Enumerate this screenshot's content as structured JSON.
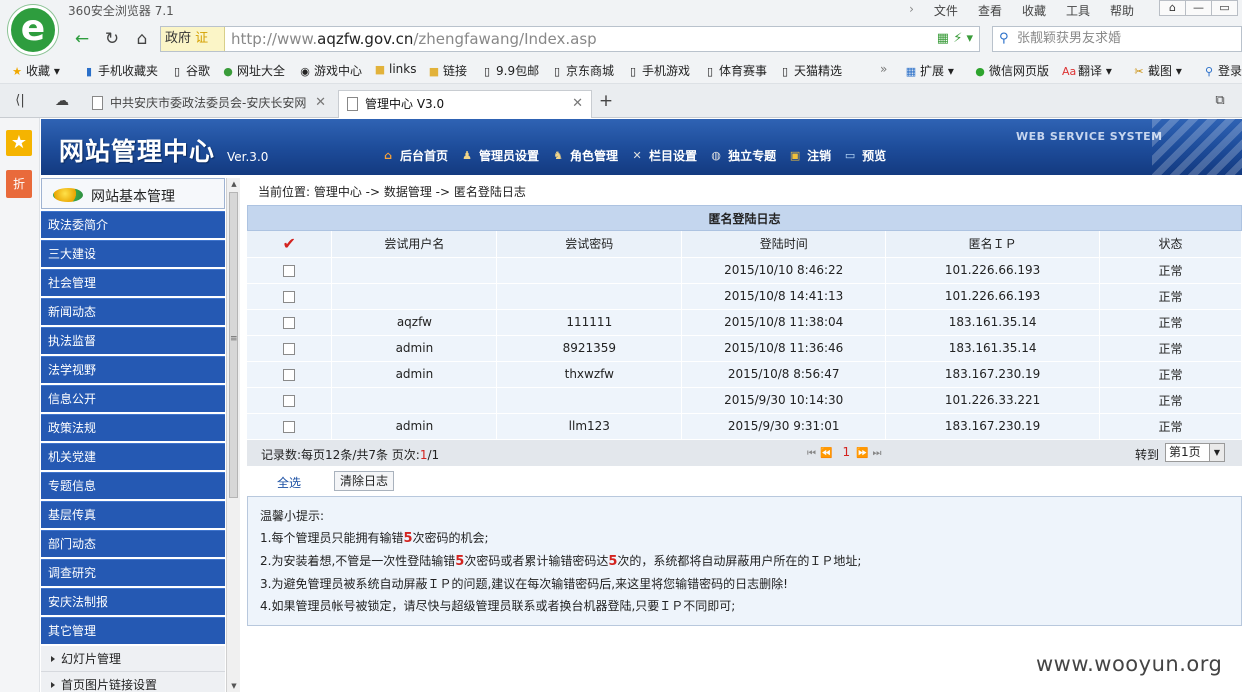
{
  "browser": {
    "logo_letter": "e",
    "app_title": "360安全浏览器 7.1",
    "menu": [
      "文件",
      "查看",
      "收藏",
      "工具",
      "帮助"
    ],
    "url_host": "http://www.",
    "url_domain": "aqzfw.gov.cn",
    "url_path": "/zhengfawang/Index.asp",
    "gov_label": "政府",
    "gov_badge": "证",
    "search_placeholder": "张靓颖获男友求婚",
    "bookmarks": [
      "收藏",
      "手机收藏夹",
      "谷歌",
      "网址大全",
      "游戏中心",
      "links",
      "链接",
      "9.9包邮",
      "京东商城",
      "手机游戏",
      "体育赛事",
      "天猫精选",
      "扩展",
      "微信网页版",
      "翻译",
      "截图",
      "登录"
    ],
    "tabs": [
      {
        "label": "中共安庆市委政法委员会-安庆长安网",
        "active": false
      },
      {
        "label": "管理中心 V3.0",
        "active": true
      }
    ]
  },
  "side": {
    "star": "★",
    "zhe": "折"
  },
  "header": {
    "title": "网站管理中心",
    "version": "Ver.3.0",
    "nav": [
      "后台首页",
      "管理员设置",
      "角色管理",
      "栏目设置",
      "独立专题",
      "注销",
      "预览"
    ],
    "tagline": "WEB SERVICE SYSTEM"
  },
  "leftmenu": {
    "head": "网站基本管理",
    "items": [
      "政法委简介",
      "三大建设",
      "社会管理",
      "新闻动态",
      "执法监督",
      "法学视野",
      "信息公开",
      "政策法规",
      "机关党建",
      "专题信息",
      "基层传真",
      "部门动态",
      "调查研究",
      "安庆法制报",
      "其它管理"
    ],
    "subs": [
      "幻灯片管理",
      "首页图片链接设置"
    ]
  },
  "main": {
    "breadcrumb": "当前位置: 管理中心 -> 数据管理 -> 匿名登陆日志",
    "panel_title": "匿名登陆日志",
    "columns": [
      "✔",
      "尝试用户名",
      "尝试密码",
      "登陆时间",
      "匿名ＩＰ",
      "状态"
    ],
    "rows": [
      {
        "user": "",
        "pass": "",
        "time": "2015/10/10 8:46:22",
        "ip": "101.226.66.193",
        "status": "正常"
      },
      {
        "user": "",
        "pass": "",
        "time": "2015/10/8 14:41:13",
        "ip": "101.226.66.193",
        "status": "正常"
      },
      {
        "user": "aqzfw",
        "pass": "111111",
        "time": "2015/10/8 11:38:04",
        "ip": "183.161.35.14",
        "status": "正常"
      },
      {
        "user": "admin",
        "pass": "8921359",
        "time": "2015/10/8 11:36:46",
        "ip": "183.161.35.14",
        "status": "正常"
      },
      {
        "user": "admin",
        "pass": "thxwzfw",
        "time": "2015/10/8 8:56:47",
        "ip": "183.167.230.19",
        "status": "正常"
      },
      {
        "user": "",
        "pass": "",
        "time": "2015/9/30 10:14:30",
        "ip": "101.226.33.221",
        "status": "正常"
      },
      {
        "user": "admin",
        "pass": "llm123",
        "time": "2015/9/30 9:31:01",
        "ip": "183.167.230.19",
        "status": "正常"
      }
    ],
    "pager": {
      "info_prefix": "记录数:每页12条/共7条  页次:",
      "current": "1",
      "total": "/1",
      "page_num": "1",
      "goto": "转到",
      "select_value": "第1页"
    },
    "select_all": "全选",
    "clear_log": "清除日志",
    "tips": {
      "title": "温馨小提示:",
      "l1a": "1.每个管理员只能拥有输错",
      "l1n": "5",
      "l1b": "次密码的机会;",
      "l2a": "2.为安装着想,不管是一次性登陆输错",
      "l2n": "5",
      "l2b": "次密码或者累计输错密码达",
      "l2n2": "5",
      "l2c": "次的，系统都将自动屏蔽用户所在的ＩＰ地址;",
      "l3": "3.为避免管理员被系统自动屏蔽ＩＰ的问题,建议在每次输错密码后,来这里将您输错密码的日志删除!",
      "l4": "4.如果管理员帐号被锁定，请尽快与超级管理员联系或者换台机器登陆,只要ＩＰ不同即可;"
    }
  },
  "watermark": "www.wooyun.org",
  "colors": {
    "header": "#1e4d9b",
    "menu": "#2559b3",
    "accent": "#d3231f"
  }
}
